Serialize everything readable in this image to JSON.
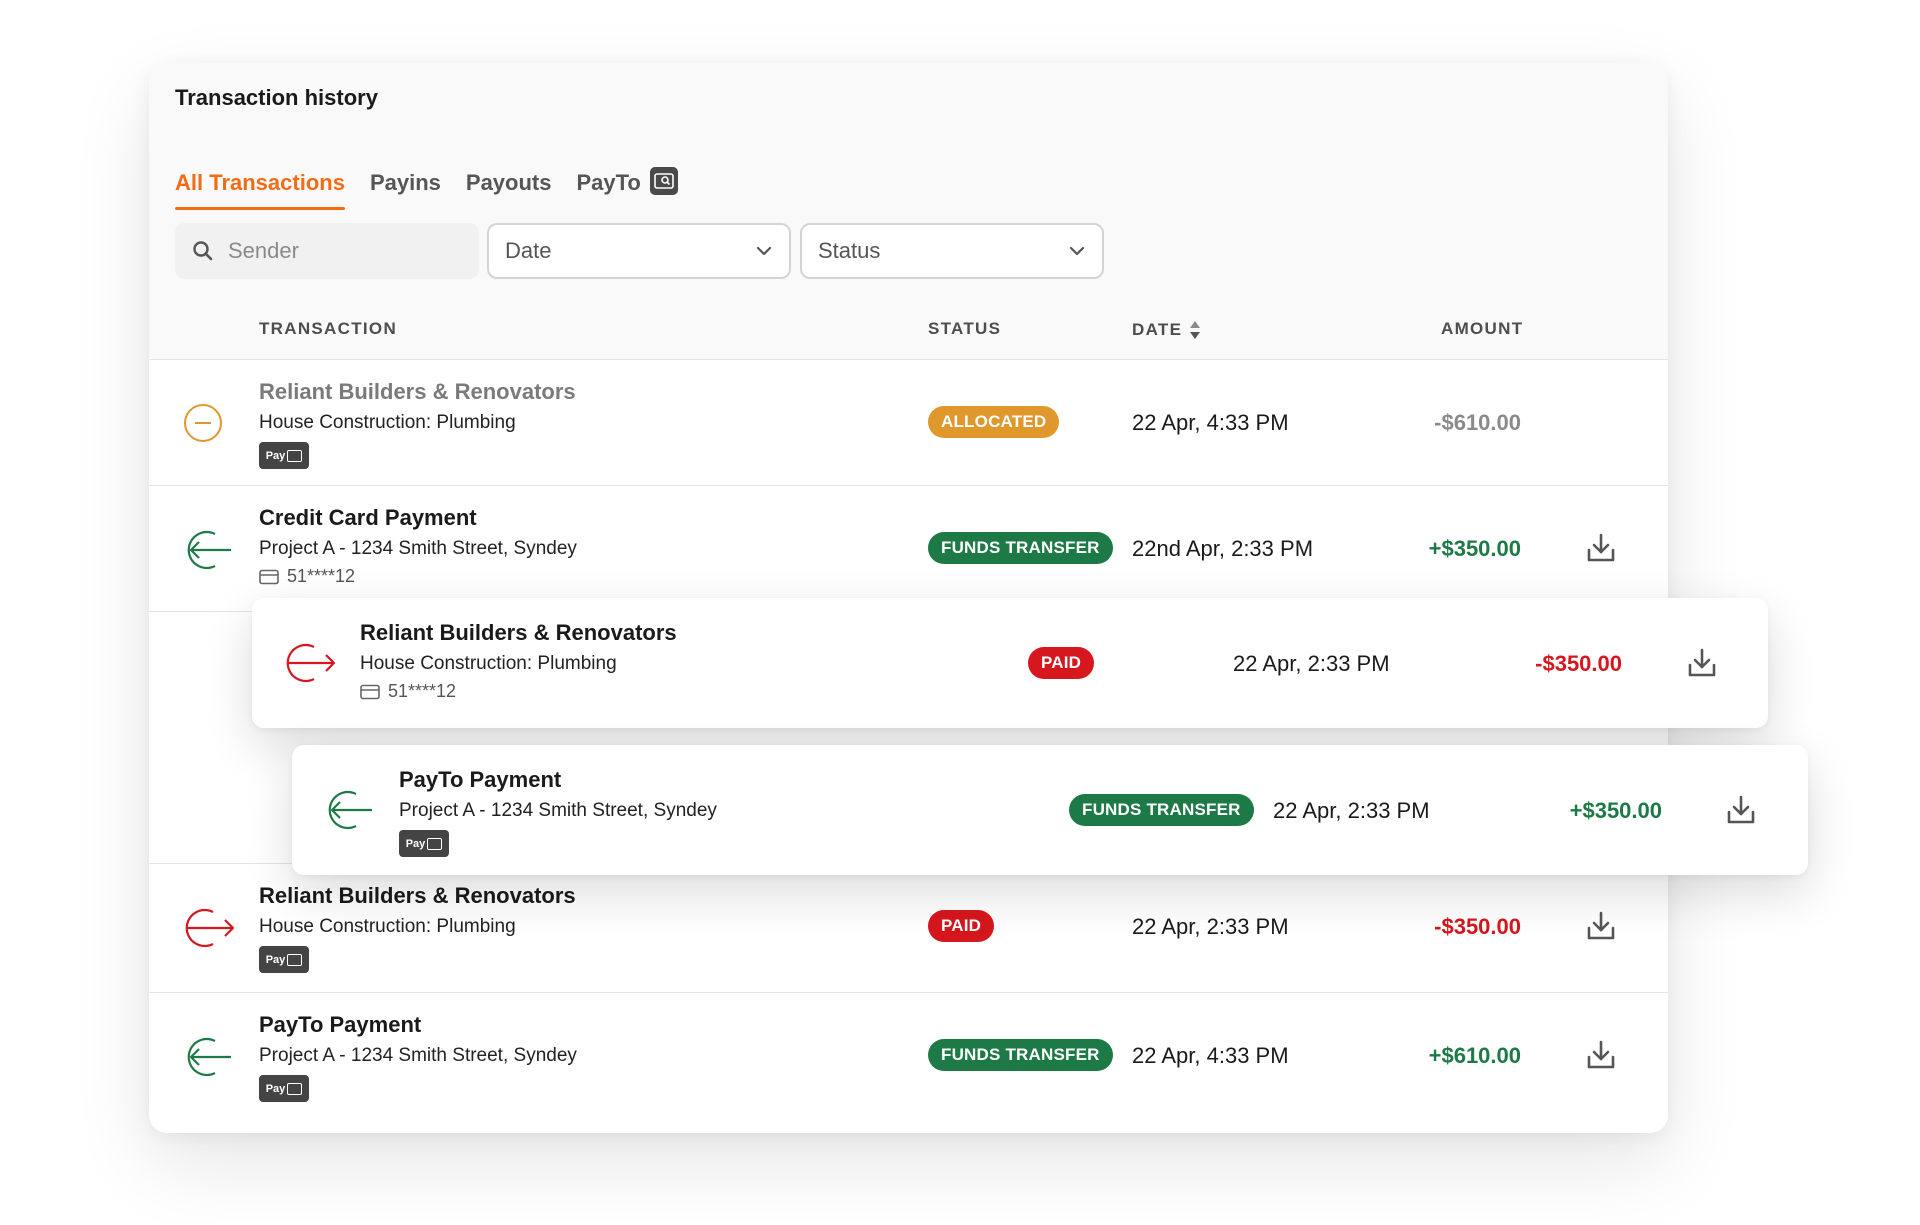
{
  "title": "Transaction history",
  "tabs": [
    {
      "label": "All Transactions",
      "active": true
    },
    {
      "label": "Payins"
    },
    {
      "label": "Payouts"
    },
    {
      "label": "PayTo"
    }
  ],
  "filters": {
    "search_placeholder": "Sender",
    "date_label": "Date",
    "status_label": "Status"
  },
  "columns": {
    "transaction": "TRANSACTION",
    "status": "STATUS",
    "date": "DATE",
    "amount": "AMOUNT"
  },
  "chip_text": "Pay",
  "colors": {
    "accent": "#f26c16",
    "allocated": "#e0982d",
    "funds_transfer": "#1d7a46",
    "paid": "#d6171d"
  },
  "rows": [
    {
      "direction": "pending",
      "name": "Reliant Builders & Renovators",
      "desc": "House Construction: Plumbing",
      "meta": "payto",
      "status": "ALLOCATED",
      "date": "22 Apr, 4:33 PM",
      "amount": "-$610.00"
    },
    {
      "direction": "in",
      "name": "Credit Card Payment",
      "desc": "Project A - 1234 Smith Street, Syndey",
      "meta": "card",
      "card": "51****12",
      "status": "FUNDS TRANSFER",
      "date": "22nd Apr, 2:33 PM",
      "amount": "+$350.00"
    },
    {
      "direction": "out",
      "name": "Reliant Builders & Renovators",
      "desc": "House Construction: Plumbing",
      "meta": "card",
      "card": "51****12",
      "status": "PAID",
      "date": "22 Apr, 2:33 PM",
      "amount": "-$350.00"
    },
    {
      "direction": "in",
      "name": "PayTo Payment",
      "desc": "Project A - 1234 Smith Street, Syndey",
      "meta": "payto",
      "status": "FUNDS TRANSFER",
      "date": "22 Apr, 2:33 PM",
      "amount": "+$350.00"
    },
    {
      "direction": "out",
      "name": "Reliant Builders & Renovators",
      "desc": "House Construction: Plumbing",
      "meta": "payto",
      "status": "PAID",
      "date": "22 Apr, 2:33 PM",
      "amount": "-$350.00"
    },
    {
      "direction": "in",
      "name": "PayTo Payment",
      "desc": "Project A - 1234 Smith Street, Syndey",
      "meta": "payto",
      "status": "FUNDS TRANSFER",
      "date": "22 Apr, 4:33 PM",
      "amount": "+$610.00"
    }
  ]
}
